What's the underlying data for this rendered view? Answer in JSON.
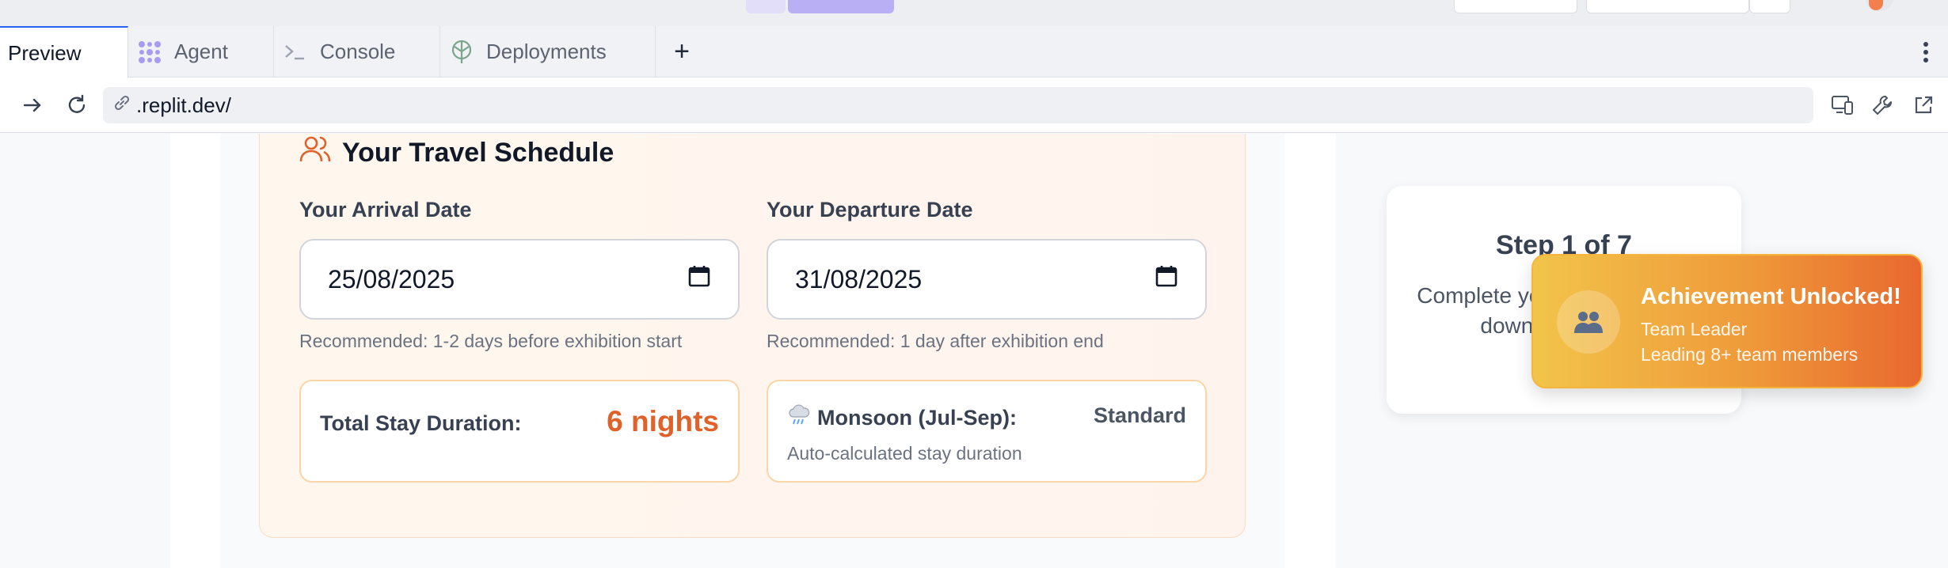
{
  "tabs": [
    {
      "label": "Preview",
      "icon": "none",
      "active": true
    },
    {
      "label": "Agent",
      "icon": "agent-icon",
      "active": false
    },
    {
      "label": "Console",
      "icon": "terminal-icon",
      "active": false
    },
    {
      "label": "Deployments",
      "icon": "deployments-icon",
      "active": false
    }
  ],
  "address": {
    "url": ".replit.dev/"
  },
  "schedule": {
    "title": "Your Travel Schedule",
    "arrival": {
      "label": "Your Arrival Date",
      "value": "25/08/2025",
      "hint": "Recommended: 1-2 days before exhibition start"
    },
    "departure": {
      "label": "Your Departure Date",
      "value": "31/08/2025",
      "hint": "Recommended: 1 day after exhibition end"
    },
    "stay": {
      "label": "Total Stay Duration:",
      "value": "6 nights"
    },
    "season": {
      "label": "Monsoon (Jul-Sep):",
      "value": "Standard",
      "note": "Auto-calculated stay duration",
      "icon": "rain-cloud-icon"
    }
  },
  "progress": {
    "step": "Step 1 of 7",
    "description": "Complete your cos downl"
  },
  "toast": {
    "title": "Achievement Unlocked!",
    "line1": "Team Leader",
    "line2": "Leading 8+ team members",
    "icon": "team-icon"
  },
  "colors": {
    "accent": "#e1612a",
    "tab_active": "#2563eb"
  }
}
